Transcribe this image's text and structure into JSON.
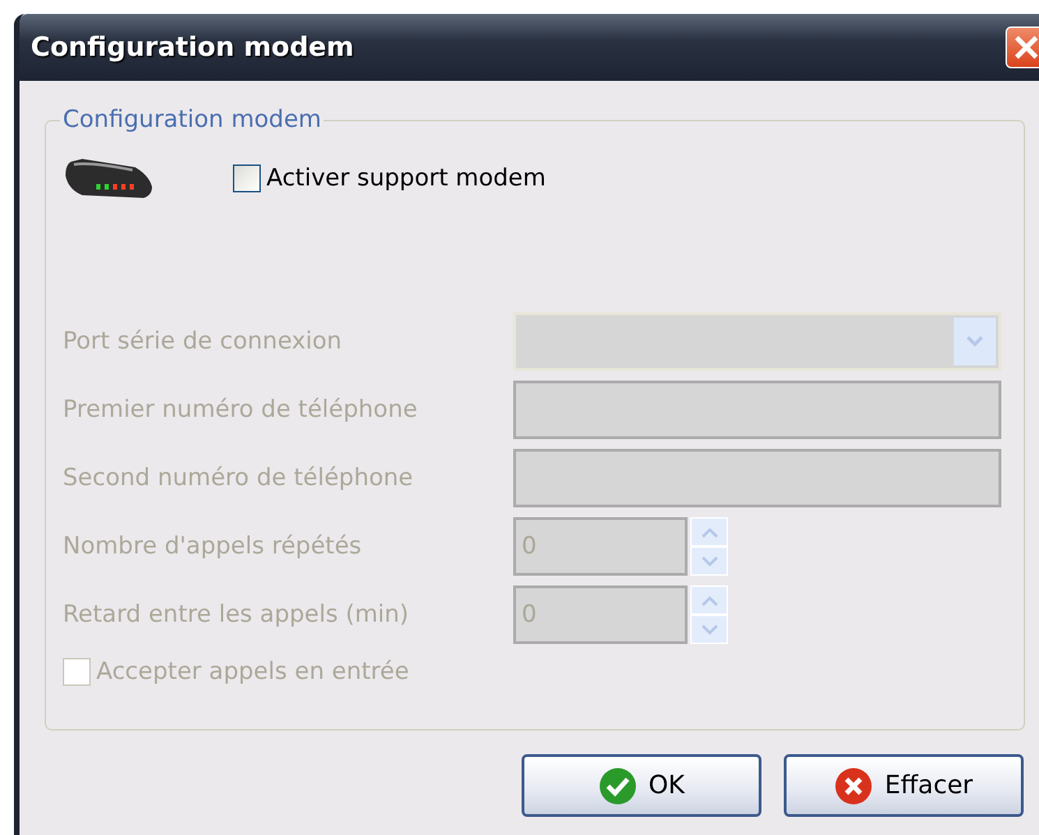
{
  "window": {
    "title": "Configuration modem"
  },
  "group": {
    "title": "Configuration modem"
  },
  "enable_modem": {
    "label": "Activer support modem",
    "checked": false,
    "disabled": false
  },
  "fields": [
    {
      "kind": "combo",
      "label": "Port série de connexion",
      "disabled": true
    },
    {
      "kind": "text",
      "label": "Premier numéro de téléphone",
      "disabled": true
    },
    {
      "kind": "text",
      "label": "Second numéro de téléphone",
      "disabled": true
    },
    {
      "kind": "spin",
      "label": "Nombre d'appels répétés",
      "value": "0",
      "disabled": true
    },
    {
      "kind": "spin",
      "label": "Retard entre les appels (min)",
      "value": "0",
      "disabled": true
    }
  ],
  "accept_calls": {
    "label": "Accepter appels en entrée",
    "checked": false,
    "disabled": true
  },
  "buttons": [
    {
      "kind": "ok",
      "label": "OK"
    },
    {
      "kind": "cancel",
      "label": "Effacer"
    }
  ]
}
